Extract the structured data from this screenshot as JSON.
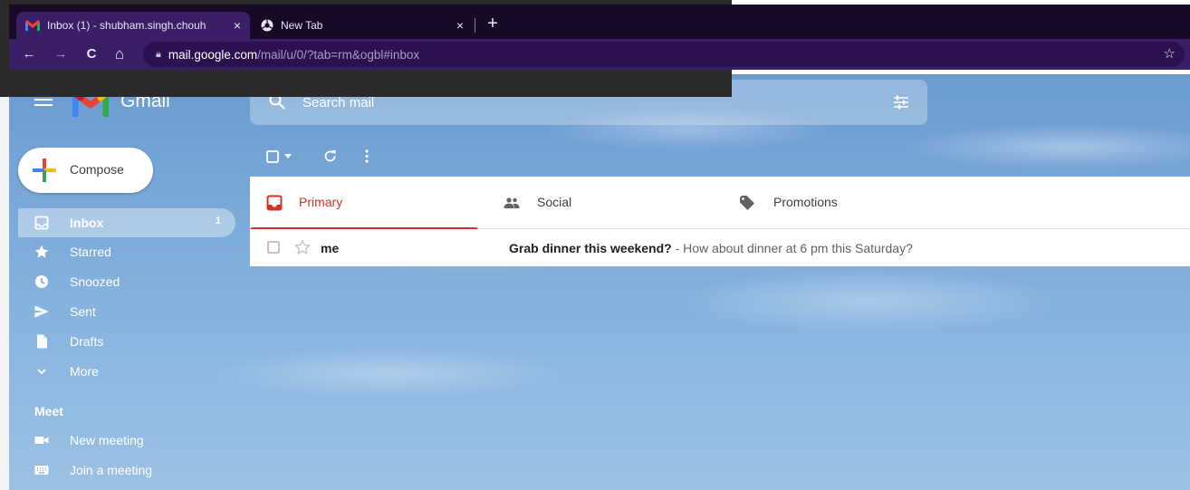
{
  "browser": {
    "tabs": [
      {
        "title": "Inbox (1) - shubham.singh.chouh",
        "close": "×"
      },
      {
        "title": "New Tab",
        "close": "×"
      }
    ],
    "new_tab": "+",
    "nav": {
      "back": "←",
      "forward": "→",
      "reload": "C",
      "home": "⌂"
    },
    "url_host": "mail.google.com",
    "url_path": "/mail/u/0/?tab=rm&ogbl#inbox"
  },
  "gmail": {
    "wordmark": "Gmail",
    "search": {
      "placeholder": "Search mail"
    },
    "compose_label": "Compose",
    "sidebar": {
      "items": [
        {
          "label": "Inbox",
          "count": "1",
          "icon": "inbox-icon"
        },
        {
          "label": "Starred",
          "icon": "star-icon"
        },
        {
          "label": "Snoozed",
          "icon": "clock-icon"
        },
        {
          "label": "Sent",
          "icon": "send-icon"
        },
        {
          "label": "Drafts",
          "icon": "draft-icon"
        },
        {
          "label": "More",
          "icon": "chevron-down-icon"
        }
      ],
      "meet": {
        "heading": "Meet",
        "items": [
          {
            "label": "New meeting",
            "icon": "video-icon"
          },
          {
            "label": "Join a meeting",
            "icon": "keyboard-icon"
          }
        ]
      }
    },
    "categories": [
      {
        "label": "Primary",
        "icon": "primary-inbox-icon"
      },
      {
        "label": "Social",
        "icon": "people-icon"
      },
      {
        "label": "Promotions",
        "icon": "tag-icon"
      }
    ],
    "emails": [
      {
        "sender": "me",
        "subject": "Grab dinner this weekend?",
        "dash": " - ",
        "snippet": "How about dinner at 6 pm this Saturday?"
      }
    ],
    "colors": {
      "primary_accent": "#d93025",
      "browser_tabstrip": "#180a26",
      "browser_toolbar": "#3a1f66"
    }
  }
}
